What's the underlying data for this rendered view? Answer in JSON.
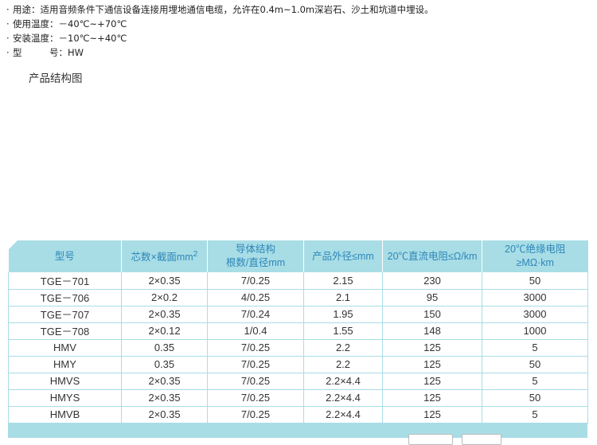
{
  "specs": [
    {
      "bullet": "·",
      "text": "用途：适用音频条件下通信设备连接用埋地通信电缆，允许在0.4m~1.0m深岩石、沙土和坑道中埋设。"
    },
    {
      "bullet": "·",
      "text": "使用温度：－40℃~+70℃"
    },
    {
      "bullet": "·",
      "text": "安装温度：－10℃~+40℃"
    },
    {
      "bullet": "·",
      "text": "型　　　号：HW"
    }
  ],
  "section_title": "产品结构图",
  "table": {
    "headers": {
      "model": "型号",
      "cores_prefix": "芯数×截面mm",
      "cores_sup": "2",
      "conductor_line1": "导体结构",
      "conductor_line2": "根数/直径mm",
      "diameter": "产品外径≤mm",
      "resistance": "20℃直流电阻≤Ω/km",
      "insulation_line1": "20℃绝缘电阻",
      "insulation_line2": "≥MΩ·km"
    },
    "rows": [
      {
        "model": "TGE－701",
        "cores": "2×0.35",
        "conductor": "7/0.25",
        "diameter": "2.15",
        "resistance": "230",
        "insulation": "50"
      },
      {
        "model": "TGE－706",
        "cores": "2×0.2",
        "conductor": "4/0.25",
        "diameter": "2.1",
        "resistance": "95",
        "insulation": "3000"
      },
      {
        "model": "TGE－707",
        "cores": "2×0.35",
        "conductor": "7/0.24",
        "diameter": "1.95",
        "resistance": "150",
        "insulation": "3000"
      },
      {
        "model": "TGE－708",
        "cores": "2×0.12",
        "conductor": "1/0.4",
        "diameter": "1.55",
        "resistance": "148",
        "insulation": "1000"
      },
      {
        "model": "HMV",
        "cores": "0.35",
        "conductor": "7/0.25",
        "diameter": "2.2",
        "resistance": "125",
        "insulation": "5"
      },
      {
        "model": "HMY",
        "cores": "0.35",
        "conductor": "7/0.25",
        "diameter": "2.2",
        "resistance": "125",
        "insulation": "50"
      },
      {
        "model": "HMVS",
        "cores": "2×0.35",
        "conductor": "7/0.25",
        "diameter": "2.2×4.4",
        "resistance": "125",
        "insulation": "5"
      },
      {
        "model": "HMYS",
        "cores": "2×0.35",
        "conductor": "7/0.25",
        "diameter": "2.2×4.4",
        "resistance": "125",
        "insulation": "50"
      },
      {
        "model": "HMVB",
        "cores": "2×0.35",
        "conductor": "7/0.25",
        "diameter": "2.2×4.4",
        "resistance": "125",
        "insulation": "5"
      }
    ]
  },
  "colors": {
    "header_bg": "#a8dde6",
    "header_text": "#2f86b8",
    "grid_line": "#a8dde6"
  }
}
